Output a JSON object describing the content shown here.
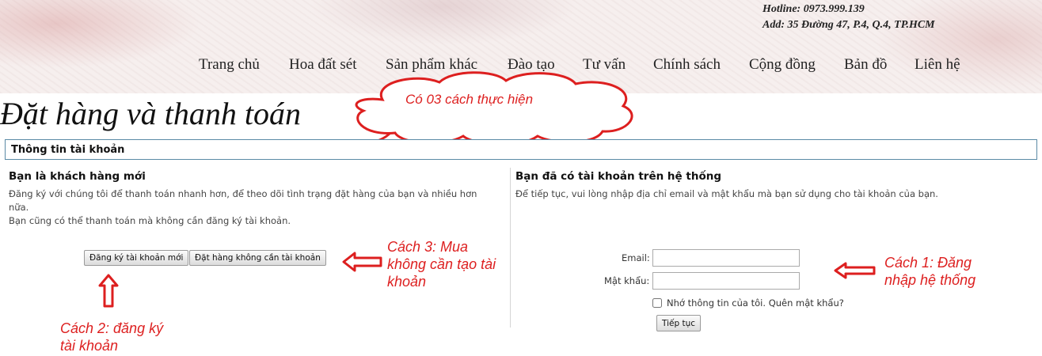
{
  "header": {
    "hotline": "Hotline: 0973.999.139",
    "address": "Add: 35 Đường 47, P.4, Q.4, TP.HCM"
  },
  "nav": {
    "items": [
      "Trang chủ",
      "Hoa đất sét",
      "Sản phẩm khác",
      "Đào tạo",
      "Tư vấn",
      "Chính sách",
      "Cộng đồng",
      "Bản đồ",
      "Liên hệ"
    ]
  },
  "page": {
    "title": "Đặt hàng và thanh toán"
  },
  "account_bar": {
    "title": "Thông tin tài khoản"
  },
  "new_customer": {
    "heading": "Bạn là khách hàng mới",
    "line1": "Đăng ký với chúng tôi để thanh toán nhanh hơn, để theo dõi tình trạng đặt hàng của bạn và nhiều hơn nữa.",
    "line2": "Bạn cũng có thể thanh toán mà không cần đăng ký tài khoản.",
    "register_button": "Đăng ký tài khoản mới",
    "guest_button": "Đặt hàng không cần tài khoản"
  },
  "existing_customer": {
    "heading": "Bạn đã có tài khoản trên hệ thống",
    "description": "Để tiếp tục, vui lòng nhập địa chỉ email và mật khẩu mà bạn sử dụng cho tài khoản của bạn.",
    "email_label": "Email:",
    "email_value": "",
    "password_label": "Mật khẩu:",
    "password_value": "",
    "remember_label": "Nhớ thông tin của tôi.",
    "forgot_link": "Quên mật khẩu?",
    "continue_button": "Tiếp tục"
  },
  "annotations": {
    "cloud": "Có 03 cách thực hiện",
    "method1_line1": "Cách 1: Đăng",
    "method1_line2": "nhập hệ thống",
    "method2_line1": "Cách 2: đăng ký",
    "method2_line2": "tài khoản",
    "method3_line1": "Cách 3: Mua",
    "method3_line2": "không cần tạo tài",
    "method3_line3": "khoản",
    "color": "#dd1f1f"
  }
}
